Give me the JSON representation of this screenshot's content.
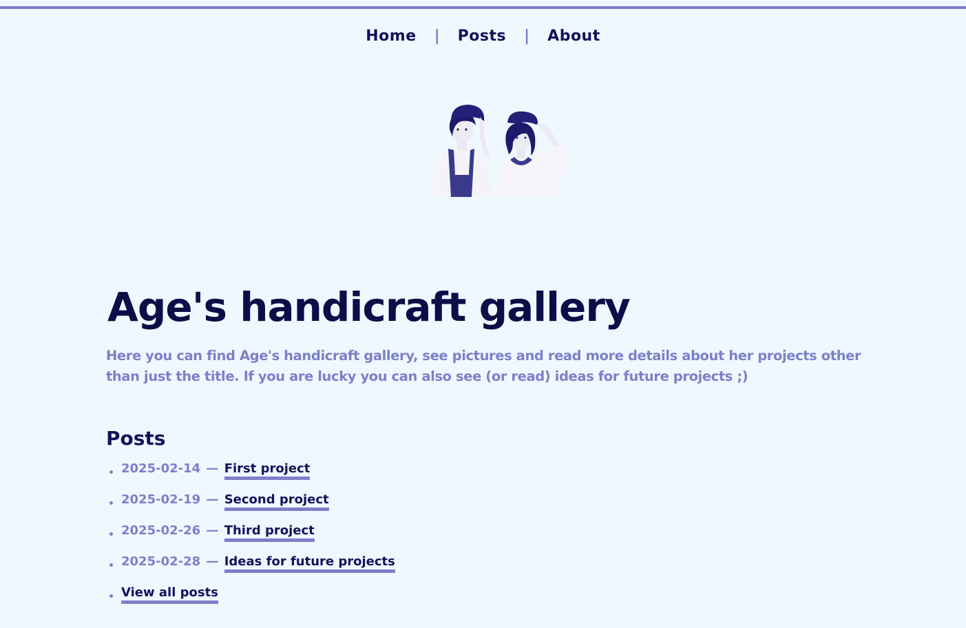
{
  "nav": {
    "items": [
      "Home",
      "Posts",
      "About"
    ],
    "separator": "|"
  },
  "hero": {
    "icon": "two-girls-portrait-image"
  },
  "header": {
    "title": "Age's handicraft gallery",
    "intro": "Here you can find Age's handicraft gallery, see pictures and read more details about her projects other than just the title. If you are lucky you can also see (or read) ideas for future projects ;)"
  },
  "posts": {
    "heading": "Posts",
    "dash": "—",
    "items": [
      {
        "date": "2025-02-14",
        "title": "First project"
      },
      {
        "date": "2025-02-19",
        "title": "Second project"
      },
      {
        "date": "2025-02-26",
        "title": "Third project"
      },
      {
        "date": "2025-02-28",
        "title": "Ideas for future projects"
      }
    ],
    "view_all": "View all posts"
  },
  "colors": {
    "background": "#eff8ff",
    "accent": "#7c80c8",
    "text": "#14125a"
  }
}
